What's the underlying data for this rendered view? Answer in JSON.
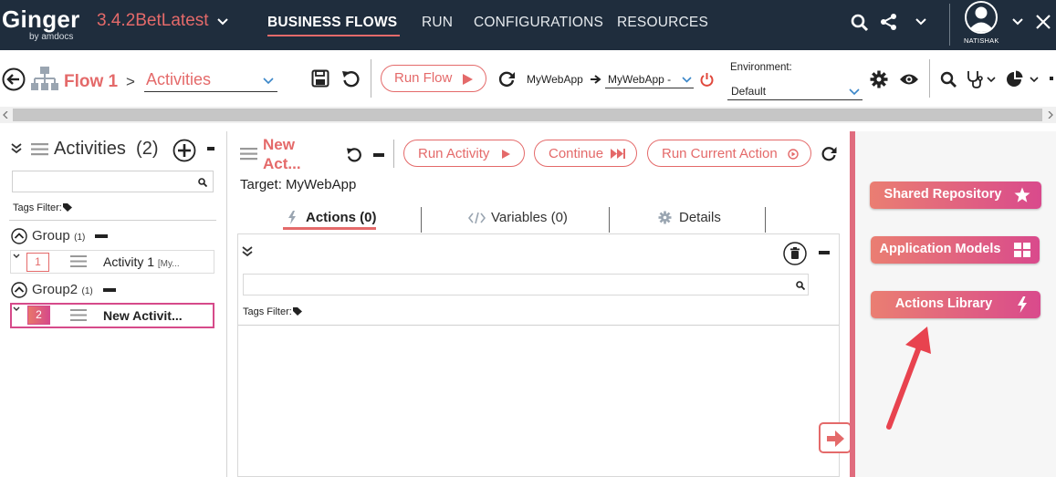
{
  "header": {
    "logo": "Ginger",
    "logo_sub": "by amdocs",
    "version": "3.4.2BetLatest",
    "nav": [
      "BUSINESS FLOWS",
      "RUN",
      "CONFIGURATIONS",
      "RESOURCES"
    ],
    "active_nav": "BUSINESS FLOWS",
    "user": "NATISHAK"
  },
  "toolbar": {
    "flow_name": "Flow 1",
    "separator": ">",
    "view_selected": "Activities",
    "run_flow": "Run Flow",
    "target_app": "MyWebApp",
    "target_agent": "MyWebApp -",
    "environment_label": "Environment:",
    "environment_value": "Default"
  },
  "left_panel": {
    "title": "Activities",
    "count": "(2)",
    "search_placeholder": "",
    "tags_filter": "Tags Filter:",
    "groups": [
      {
        "name": "Group",
        "count": "(1)",
        "activities": [
          {
            "num": "1",
            "name": "Activity 1",
            "target": "[My..."
          }
        ]
      },
      {
        "name": "Group2",
        "count": "(1)",
        "activities": [
          {
            "num": "2",
            "name": "New Activit...",
            "target": ""
          }
        ]
      }
    ],
    "selected_activity": "2"
  },
  "center_panel": {
    "activity_name": "New Act...",
    "run_activity": "Run Activity",
    "continue": "Continue",
    "run_current_action": "Run Current Action",
    "target": "Target: MyWebApp",
    "tabs": [
      {
        "label": "Actions (0)",
        "icon": "bolt-icon",
        "active": true
      },
      {
        "label": "Variables (0)",
        "icon": "code-icon",
        "active": false
      },
      {
        "label": "Details",
        "icon": "gear-icon",
        "active": false
      }
    ],
    "tags_filter": "Tags Filter:"
  },
  "right_panel": {
    "buttons": [
      {
        "label": "Shared Repository",
        "icon": "star-icon"
      },
      {
        "label": "Application Models",
        "icon": "grid-icon"
      },
      {
        "label": "Actions Library",
        "icon": "bolt-icon"
      }
    ]
  },
  "colors": {
    "accent": "#e46a6a",
    "header_bg": "#1f2d3d",
    "gradient_end": "#d94a8c",
    "arrow": "#e8434f"
  }
}
